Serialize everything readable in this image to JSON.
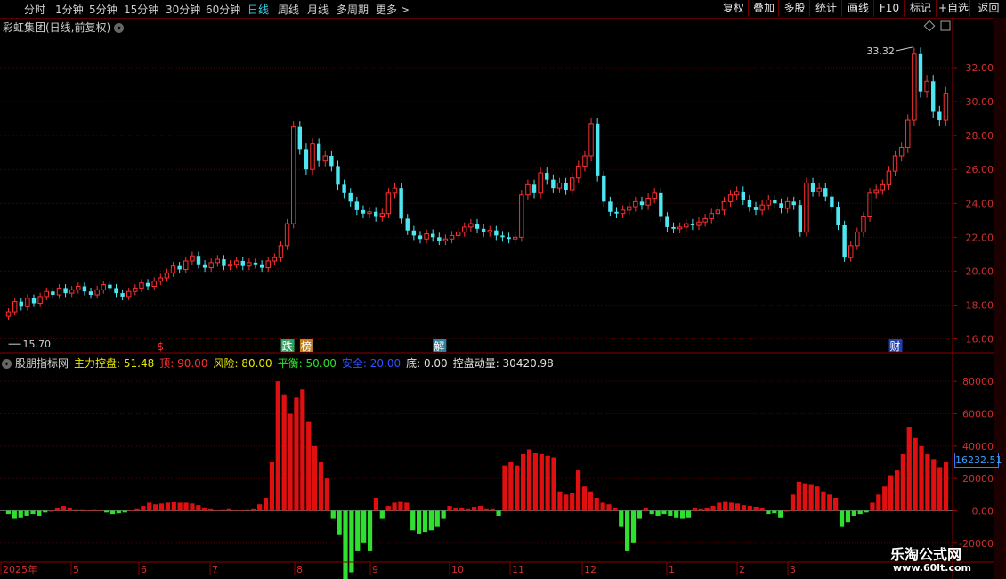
{
  "toolbar": {
    "periods": [
      "分时",
      "1分钟",
      "5分钟",
      "15分钟",
      "30分钟",
      "60分钟",
      "日线",
      "周线",
      "月线",
      "多周期",
      "更多 >"
    ],
    "active_index": 6,
    "buttons": [
      "复权",
      "叠加",
      "多股",
      "统计",
      "画线",
      "F10",
      "标记",
      "+自选",
      "返回"
    ]
  },
  "main": {
    "title": "彩虹集团(日线,前复权)",
    "y_ticks": [
      "32.00",
      "30.00",
      "28.00",
      "26.00",
      "24.00",
      "22.00",
      "20.00",
      "18.00",
      "16.00"
    ],
    "high_label": "33.32",
    "low_label": "15.70",
    "markers": [
      "$",
      "跌",
      "榜",
      "解",
      "财"
    ]
  },
  "indicator": {
    "name": "股朋指标网",
    "fields": [
      {
        "label": "主力控盘: 51.48",
        "color": "#e8e800"
      },
      {
        "label": "顶: 90.00",
        "color": "#ff3030"
      },
      {
        "label": "风险: 80.00",
        "color": "#e8e800"
      },
      {
        "label": "平衡: 50.00",
        "color": "#30e030"
      },
      {
        "label": "安全: 20.00",
        "color": "#3050ff"
      },
      {
        "label": "底: 0.00",
        "color": "#e0e0e0"
      },
      {
        "label": "控盘动量: 30420.98",
        "color": "#e0e0e0"
      }
    ],
    "y_ticks": [
      "80000",
      "60000",
      "40000",
      "20000",
      "0.00",
      "-20000"
    ],
    "current_value": "16232.51"
  },
  "xaxis": {
    "labels": [
      "2025年",
      "5",
      "6",
      "7",
      "8",
      "9",
      "10",
      "11",
      "12",
      "1",
      "2",
      "3"
    ]
  },
  "watermark": {
    "line1": "乐淘公式网",
    "line2": "www.60lt.com"
  },
  "chart_data": {
    "type": "candlestick",
    "close_series": [
      17.6,
      18.2,
      17.9,
      18.4,
      18.1,
      18.5,
      18.8,
      18.6,
      19.0,
      18.7,
      18.9,
      19.1,
      18.8,
      18.6,
      18.9,
      19.2,
      19.0,
      18.7,
      18.5,
      18.8,
      19.0,
      19.3,
      19.1,
      19.4,
      19.6,
      19.9,
      20.3,
      20.1,
      20.6,
      20.9,
      20.4,
      20.2,
      20.5,
      20.7,
      20.3,
      20.4,
      20.6,
      20.3,
      20.5,
      20.4,
      20.2,
      20.6,
      20.8,
      21.5,
      22.8,
      28.5,
      27.2,
      26.0,
      27.5,
      26.5,
      26.8,
      26.2,
      25.1,
      24.6,
      24.1,
      23.6,
      23.4,
      23.5,
      23.2,
      23.4,
      24.6,
      24.9,
      23.1,
      22.4,
      22.1,
      21.9,
      22.2,
      22.0,
      21.8,
      21.9,
      22.1,
      22.3,
      22.6,
      22.8,
      22.5,
      22.3,
      22.4,
      22.1,
      22.0,
      21.9,
      22.0,
      24.5,
      25.1,
      24.6,
      25.8,
      25.4,
      24.9,
      25.2,
      24.8,
      25.5,
      26.2,
      26.8,
      28.7,
      25.6,
      24.1,
      23.5,
      23.4,
      23.6,
      23.8,
      24.1,
      23.9,
      24.3,
      24.6,
      23.2,
      22.6,
      22.5,
      22.6,
      22.8,
      22.7,
      22.9,
      23.1,
      23.4,
      23.6,
      24.1,
      24.5,
      24.7,
      24.2,
      23.8,
      23.6,
      23.9,
      24.2,
      24.0,
      23.7,
      24.1,
      23.9,
      22.3,
      25.2,
      24.7,
      24.9,
      24.4,
      23.8,
      22.7,
      20.8,
      21.5,
      22.3,
      23.2,
      24.6,
      24.8,
      25.1,
      25.9,
      26.8,
      27.3,
      28.9,
      32.8,
      30.6,
      31.2,
      29.4,
      28.9,
      30.5
    ],
    "indicator_series": [
      -2000,
      -5000,
      -4000,
      -3000,
      -2000,
      -3000,
      -1000,
      0,
      2000,
      3000,
      2000,
      1000,
      1000,
      500,
      1000,
      500,
      -1000,
      -2000,
      -1500,
      -1000,
      500,
      1500,
      3000,
      5000,
      4000,
      4500,
      5000,
      5500,
      5000,
      5000,
      4500,
      3500,
      2000,
      1500,
      500,
      1000,
      1500,
      500,
      500,
      1000,
      1500,
      4000,
      8000,
      30000,
      80000,
      72000,
      60000,
      70000,
      75000,
      55000,
      40000,
      30000,
      20000,
      -5000,
      -15000,
      -48000,
      -38000,
      -25000,
      -20000,
      -25000,
      8000,
      -5000,
      3000,
      5000,
      6000,
      5000,
      -12000,
      -14000,
      -13000,
      -12000,
      -10000,
      -5000,
      3000,
      2000,
      2000,
      1500,
      2500,
      3000,
      1500,
      1500,
      -3000,
      28000,
      30000,
      28000,
      35000,
      38000,
      36000,
      35000,
      34000,
      33000,
      12000,
      10000,
      11000,
      25000,
      15000,
      12000,
      8000,
      5000,
      4000,
      2000,
      -10000,
      -25000,
      -20000,
      -5000,
      2000,
      -2000,
      -3000,
      -2000,
      -3000,
      -4000,
      -5000,
      -4000,
      2000,
      1500,
      2000,
      3000,
      5000,
      6000,
      5000,
      4500,
      3500,
      3000,
      2500,
      2000,
      -2000,
      -1500,
      -4000,
      0,
      10000,
      18000,
      17000,
      16500,
      15000,
      12000,
      10000,
      8000,
      -10000,
      -7000,
      -3000,
      -2000,
      -1000,
      5000,
      10000,
      15000,
      22000,
      25000,
      35000,
      52000,
      45000,
      40000,
      35000,
      32000,
      27000,
      30000
    ],
    "price_axis": [
      15.5,
      34.0
    ],
    "indicator_axis": [
      -30000,
      90000
    ]
  }
}
